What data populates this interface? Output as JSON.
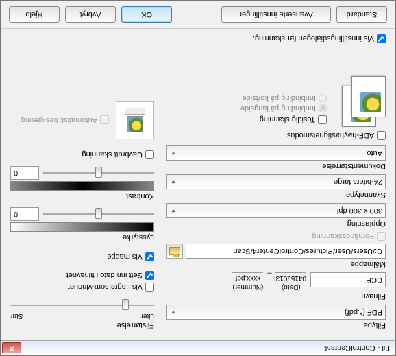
{
  "window": {
    "title": "Fil - ControlCenter4"
  },
  "left": {
    "filetype_label": "Filtype",
    "filetype_value": "PDF (*.pdf)",
    "filename_label": "Filnavn",
    "filename_value": "CCF",
    "date_header": "(Dato)",
    "date_value": "04152013",
    "num_header": "(Nummer)",
    "num_value": "xxxx.pdf",
    "dest_label": "Målmappe",
    "dest_value": "C:/Users/User/Pictures/ControlCenter4/Scan",
    "prescan_label": "Forhåndsskanning",
    "resolution_label": "Oppløsning",
    "resolution_value": "300 x 300 dpi",
    "scantype_label": "Skannetype",
    "scantype_value": "24-biters farge",
    "docsize_label": "Dokumentstørrelse",
    "docsize_value": "Auto",
    "adf_label": "ADF-høyhastighetsmodus",
    "duplex_label": "Tosidig skanning",
    "bind_long": "Innbinding på langside",
    "bind_short": "Innbinding på kortside"
  },
  "right": {
    "size_label": "Filstørrelse",
    "size_small": "Liten",
    "size_large": "Stor",
    "show_saveas": "Vis Lagre som-vinduet",
    "insert_date": "Sett inn dato i filnavnet",
    "show_folder": "Vis mappe",
    "brightness_label": "Lysstyrke",
    "brightness_value": "0",
    "contrast_label": "Kontrast",
    "contrast_value": "0",
    "continuous_label": "Uavbrutt skanning",
    "autocrop_label": "Automatisk beskjæring"
  },
  "footer": {
    "show_dialog": "Vis innstillingsdialogen før skanning.",
    "standard": "Standard",
    "advanced": "Avanserte innstillinger",
    "ok": "OK",
    "cancel": "Avbryt",
    "help": "Hjelp"
  }
}
